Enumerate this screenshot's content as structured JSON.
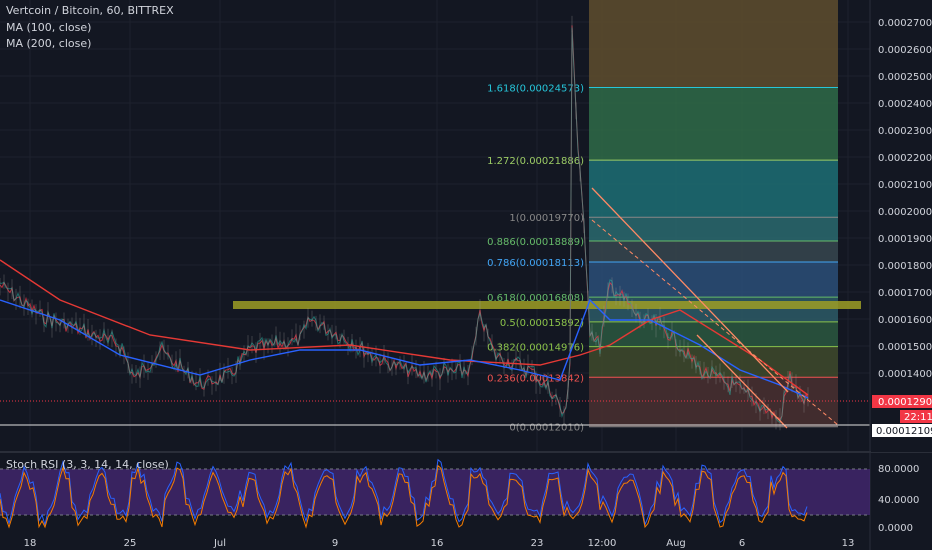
{
  "header": {
    "symbol_line": "Vertcoin / Bitcoin, 60, BITTREX",
    "ma1": "MA (100, close)",
    "ma2": "MA (200, close)"
  },
  "price_axis": {
    "ticks": [
      "0.00027000",
      "0.00026000",
      "0.00025000",
      "0.00024000",
      "0.00023000",
      "0.00022000",
      "0.00021000",
      "0.00020000",
      "0.00019000",
      "0.00018000",
      "0.00017000",
      "0.00016000",
      "0.00015000",
      "0.00014000"
    ],
    "last_price": "0.00012900",
    "countdown": "22:11",
    "low_label": "0.00012109"
  },
  "fib_levels": [
    {
      "label": "1.618(0.00024573)",
      "color": "#26c6da",
      "fill": "#2f6b48"
    },
    {
      "label": "1.272(0.00021886)",
      "color": "#9ccc65",
      "fill": "#1d6f74"
    },
    {
      "label": "1(0.00019770)",
      "color": "#888888",
      "fill": "#2a6a6e"
    },
    {
      "label": "0.886(0.00018889)",
      "color": "#66bb6a",
      "fill": "#37474f"
    },
    {
      "label": "0.786(0.00018113)",
      "color": "#42a5f5",
      "fill": "#2b4f78"
    },
    {
      "label": "0.618(0.00016808)",
      "color": "#66bb6a",
      "fill": "#2d5a66"
    },
    {
      "label": "0.5(0.00015892)",
      "color": "#8bc34a",
      "fill": "#2c5840"
    },
    {
      "label": "0.382(0.00014976)",
      "color": "#8bc34a",
      "fill": "#3f4a2c"
    },
    {
      "label": "0.236(0.00013842)",
      "color": "#ef5350",
      "fill": "#4a3030"
    },
    {
      "label": "0(0.00012010)",
      "color": "#888888",
      "fill": "#4a2632"
    }
  ],
  "fib_top_fill": "#5b4a2e",
  "stoch": {
    "title": "Stoch RSI (3, 3, 14, 14, close)",
    "ticks": [
      "80.0000",
      "40.0000",
      "0.0000"
    ],
    "fill": "#4a2a7a"
  },
  "time_axis": {
    "labels": [
      "18",
      "25",
      "Jul",
      "9",
      "16",
      "23",
      "12:00",
      "Aug",
      "6",
      "13"
    ]
  },
  "colors": {
    "background": "#131722",
    "price_line": "#f23645",
    "ma100": "#2962ff",
    "ma200": "#e53935",
    "resistance_zone": "#9e9d24",
    "trend_line": "#ff7f50"
  }
}
